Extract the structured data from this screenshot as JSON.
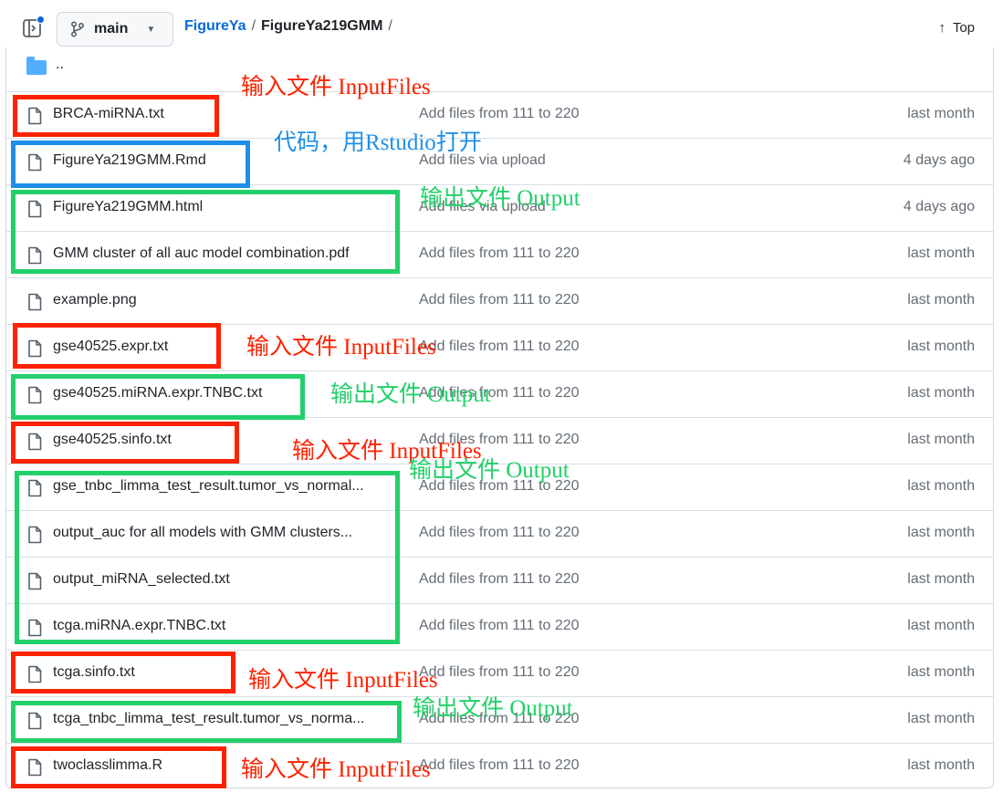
{
  "header": {
    "branch": "main",
    "repo": "FigureYa",
    "path_sep": "/",
    "dir": "FigureYa219GMM",
    "trailing_sep": "/",
    "top_label": "Top"
  },
  "parent_row": {
    "label": ".."
  },
  "files": [
    {
      "name": "BRCA-miRNA.txt",
      "commit": "Add files from 111 to 220",
      "date": "last month"
    },
    {
      "name": "FigureYa219GMM.Rmd",
      "commit": "Add files via upload",
      "date": "4 days ago"
    },
    {
      "name": "FigureYa219GMM.html",
      "commit": "Add files via upload",
      "date": "4 days ago"
    },
    {
      "name": "GMM cluster of all auc model combination.pdf",
      "commit": "Add files from 111 to 220",
      "date": "last month"
    },
    {
      "name": "example.png",
      "commit": "Add files from 111 to 220",
      "date": "last month"
    },
    {
      "name": "gse40525.expr.txt",
      "commit": "Add files from 111 to 220",
      "date": "last month"
    },
    {
      "name": "gse40525.miRNA.expr.TNBC.txt",
      "commit": "Add files from 111 to 220",
      "date": "last month"
    },
    {
      "name": "gse40525.sinfo.txt",
      "commit": "Add files from 111 to 220",
      "date": "last month"
    },
    {
      "name": "gse_tnbc_limma_test_result.tumor_vs_normal...",
      "commit": "Add files from 111 to 220",
      "date": "last month"
    },
    {
      "name": "output_auc for all models with GMM clusters...",
      "commit": "Add files from 111 to 220",
      "date": "last month"
    },
    {
      "name": "output_miRNA_selected.txt",
      "commit": "Add files from 111 to 220",
      "date": "last month"
    },
    {
      "name": "tcga.miRNA.expr.TNBC.txt",
      "commit": "Add files from 111 to 220",
      "date": "last month"
    },
    {
      "name": "tcga.sinfo.txt",
      "commit": "Add files from 111 to 220",
      "date": "last month"
    },
    {
      "name": "tcga_tnbc_limma_test_result.tumor_vs_norma...",
      "commit": "Add files from 111 to 220",
      "date": "last month"
    },
    {
      "name": "twoclasslimma.R",
      "commit": "Add files from 111 to 220",
      "date": "last month"
    }
  ],
  "annotations": {
    "input_files": "输入文件 InputFiles",
    "code_open": "代码，用Rstudio打开",
    "output_files": "输出文件 Output"
  },
  "colors": {
    "input": "#ff2200",
    "code": "#1e8fe8",
    "output": "#22d06a",
    "link": "#0969da"
  }
}
